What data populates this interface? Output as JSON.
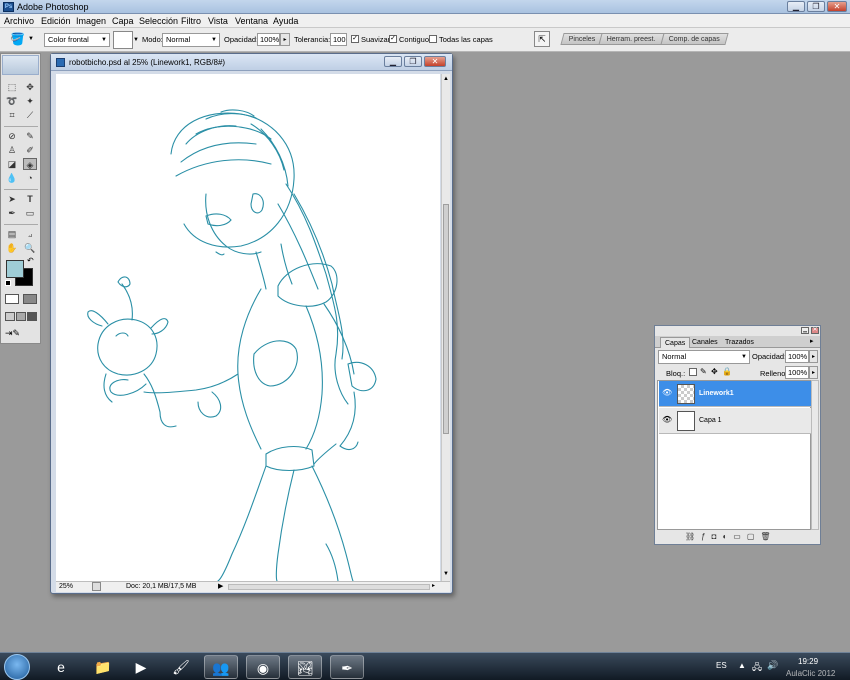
{
  "window": {
    "title": "Adobe Photoshop"
  },
  "menu": [
    "Archivo",
    "Edición",
    "Imagen",
    "Capa",
    "Selección",
    "Filtro",
    "Vista",
    "Ventana",
    "Ayuda"
  ],
  "options": {
    "fill_source": "Color frontal",
    "mode_label": "Modo:",
    "mode_value": "Normal",
    "opacity_label": "Opacidad:",
    "opacity_value": "100%",
    "tolerance_label": "Tolerancia:",
    "tolerance_value": "100",
    "antialias_label": "Suavizar",
    "contiguous_label": "Contiguo",
    "all_layers_label": "Todas las capas"
  },
  "palette_well": [
    "Pinceles",
    "Herram. preest.",
    "Comp. de capas"
  ],
  "document": {
    "title": "robotbicho.psd al 25% (Linework1, RGB/8#)",
    "zoom": "25%",
    "doc_size": "Doc: 20,1 MB/17,5 MB"
  },
  "layers_panel": {
    "tabs": [
      "Capas",
      "Canales",
      "Trazados"
    ],
    "blend_mode": "Normal",
    "opacity_label": "Opacidad:",
    "opacity_value": "100%",
    "lock_label": "Bloq.:",
    "fill_label": "Relleno:",
    "fill_value": "100%",
    "layers": [
      {
        "name": "Linework1",
        "selected": true,
        "visible": true
      },
      {
        "name": "Capa 1",
        "selected": false,
        "visible": true
      }
    ]
  },
  "taskbar": {
    "language": "ES",
    "time": "19:29",
    "watermark": "AulaClic 2012"
  },
  "colors": {
    "foreground": "#9fcdd6",
    "background": "#000000",
    "line_art": "#2a8fa6",
    "selection": "#3d8ee8"
  }
}
